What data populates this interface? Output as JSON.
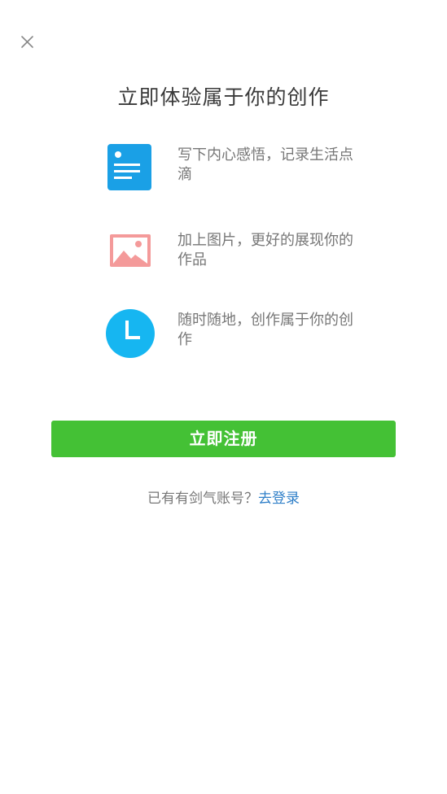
{
  "close_icon": "close-icon",
  "title": "立即体验属于你的创作",
  "features": [
    {
      "icon": "document-icon",
      "color": "#1aa0e6",
      "text": "写下内心感悟，记录生活点滴"
    },
    {
      "icon": "image-icon",
      "color": "#f49a9a",
      "text": "加上图片，更好的展现你的作品"
    },
    {
      "icon": "clock-icon",
      "color": "#16b6f1",
      "text": "随时随地，创作属于你的创作"
    }
  ],
  "register_button": "立即注册",
  "login_prompt": "已有有剑气账号？",
  "login_link": "去登录",
  "colors": {
    "primary_green": "#44c135",
    "link_blue": "#2f7fc8"
  }
}
